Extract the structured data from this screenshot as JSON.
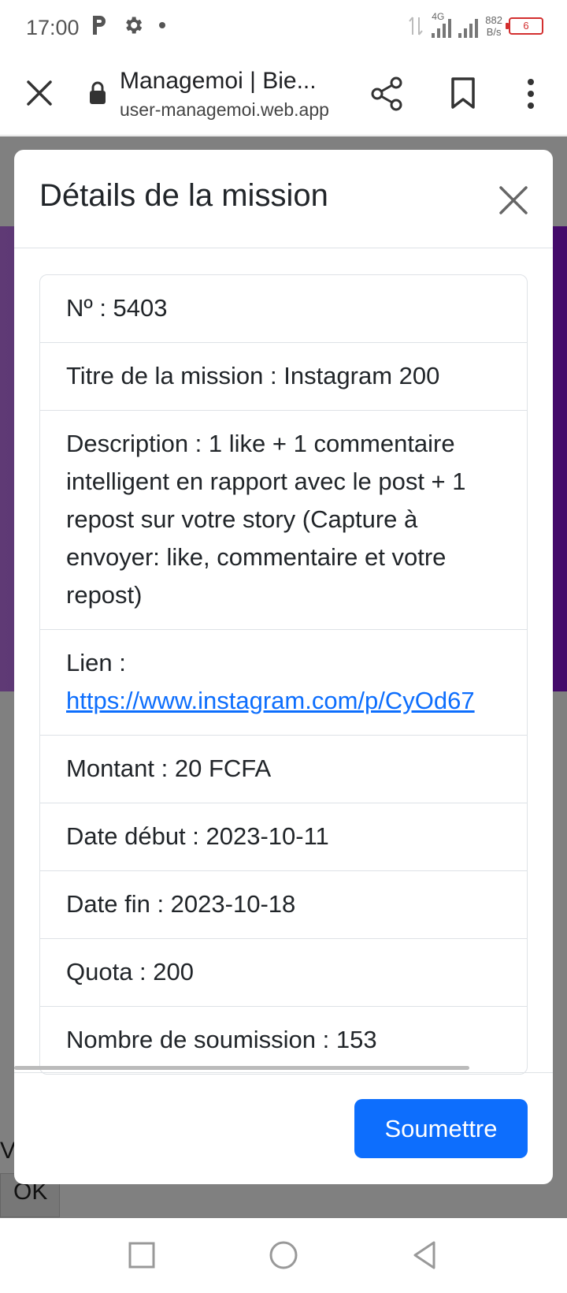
{
  "status_bar": {
    "time": "17:00",
    "network_type": "4G",
    "net_speed_value": "882",
    "net_speed_unit": "B/s",
    "battery_level": "6"
  },
  "browser": {
    "title": "Managemoi | Bie...",
    "url": "user-managemoi.web.app"
  },
  "modal": {
    "title": "Détails de la mission",
    "details": [
      {
        "label": "Nº : 5403"
      },
      {
        "label": "Titre de la mission : Instagram 200"
      },
      {
        "label": "Description : 1 like + 1 commentaire intelligent en rapport avec le post + 1 repost sur votre story (Capture à envoyer: like, commentaire et votre repost)"
      },
      {
        "label": "Lien :",
        "link": "https://www.instagram.com/p/CyOd67"
      },
      {
        "label": "Montant : 20 FCFA"
      },
      {
        "label": "Date début : 2023-10-11"
      },
      {
        "label": "Date fin : 2023-10-18"
      },
      {
        "label": "Quota : 200"
      },
      {
        "label": "Nombre de soumission : 153"
      }
    ],
    "submit_label": "Soumettre"
  },
  "background_page": {
    "partial_text": "V",
    "ok_button": "OK"
  },
  "colors": {
    "primary": "#0d6efd",
    "overlay": "#808080",
    "purple": "#50207a"
  }
}
